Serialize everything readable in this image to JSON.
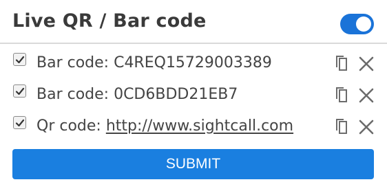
{
  "header": {
    "title": "Live QR / Bar code",
    "toggle_on": true
  },
  "codes": [
    {
      "checked": true,
      "prefix": "Bar code: ",
      "value": "C4REQ15729003389",
      "is_link": false
    },
    {
      "checked": true,
      "prefix": "Bar code: ",
      "value": "0CD6BDD21EB7",
      "is_link": false
    },
    {
      "checked": true,
      "prefix": "Qr code: ",
      "value": "http://www.sightcall.com",
      "is_link": true
    }
  ],
  "icons": {
    "copy": "copy-icon",
    "close": "close-icon",
    "check": "check-icon"
  },
  "colors": {
    "accent": "#1a7fe0",
    "toggle": "#1a73d8",
    "icon": "#6b6b6b"
  },
  "actions": {
    "submit_label": "SUBMIT"
  }
}
